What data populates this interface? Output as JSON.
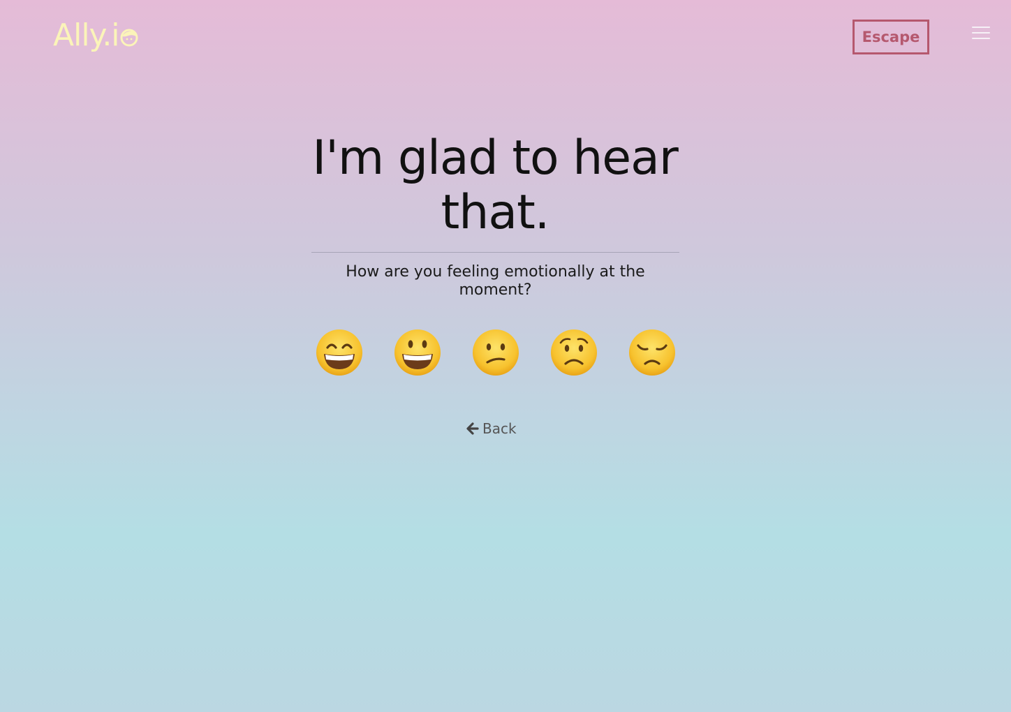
{
  "header": {
    "logo_text": "Ally.i",
    "escape_label": "Escape"
  },
  "main": {
    "headline_line1": "I'm glad to hear",
    "headline_line2": "that.",
    "question": "How are you feeling emotionally at the moment?",
    "mood_options": [
      {
        "icon": "grinning-smiling-eyes-icon"
      },
      {
        "icon": "grinning-face-icon"
      },
      {
        "icon": "confused-face-icon"
      },
      {
        "icon": "worried-face-icon"
      },
      {
        "icon": "disappointed-face-icon"
      }
    ],
    "back_label": "Back"
  },
  "colors": {
    "logo": "#fbf4b9",
    "escape_accent": "#b5586e",
    "emoji_face": "#f7c22e"
  }
}
